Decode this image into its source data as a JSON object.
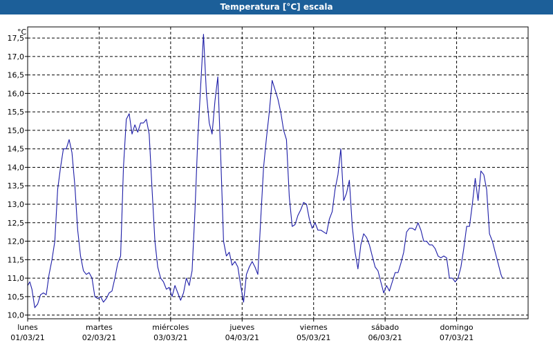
{
  "window": {
    "title": "Temperatura [°C] escala"
  },
  "chart_data": {
    "type": "line",
    "title": "Temperatura [°C] escala",
    "ylabel": "°C",
    "xlabel": "",
    "ylim": [
      9.9,
      17.8
    ],
    "xlim": [
      0,
      7.0
    ],
    "y_ticks": [
      "10,0",
      "10,5",
      "11,0",
      "11,5",
      "12,0",
      "12,5",
      "13,0",
      "13,5",
      "14,0",
      "14,5",
      "15,0",
      "15,5",
      "16,0",
      "16,5",
      "17,0",
      "17,5"
    ],
    "y_tick_values": [
      10.0,
      10.5,
      11.0,
      11.5,
      12.0,
      12.5,
      13.0,
      13.5,
      14.0,
      14.5,
      15.0,
      15.5,
      16.0,
      16.5,
      17.0,
      17.5
    ],
    "x_ticks": [
      {
        "day": "lunes",
        "date": "01/03/21",
        "value": 0
      },
      {
        "day": "martes",
        "date": "02/03/21",
        "value": 1
      },
      {
        "day": "miércoles",
        "date": "03/03/21",
        "value": 2
      },
      {
        "day": "jueves",
        "date": "04/03/21",
        "value": 3
      },
      {
        "day": "viernes",
        "date": "05/03/21",
        "value": 4
      },
      {
        "day": "sábado",
        "date": "06/03/21",
        "value": 5
      },
      {
        "day": "domingo",
        "date": "07/03/21",
        "value": 6
      }
    ],
    "grid": true,
    "colors": {
      "line": "#1a1aa6",
      "titlebar": "#1c5f99",
      "grid": "#000000"
    },
    "series": [
      {
        "values": [
          [
            0.0,
            10.8
          ],
          [
            0.03,
            10.9
          ],
          [
            0.06,
            10.7
          ],
          [
            0.1,
            10.2
          ],
          [
            0.14,
            10.3
          ],
          [
            0.18,
            10.55
          ],
          [
            0.22,
            10.6
          ],
          [
            0.26,
            10.55
          ],
          [
            0.3,
            11.1
          ],
          [
            0.34,
            11.5
          ],
          [
            0.38,
            12.0
          ],
          [
            0.42,
            13.4
          ],
          [
            0.46,
            14.0
          ],
          [
            0.5,
            14.5
          ],
          [
            0.54,
            14.5
          ],
          [
            0.58,
            14.75
          ],
          [
            0.62,
            14.4
          ],
          [
            0.66,
            13.5
          ],
          [
            0.7,
            12.3
          ],
          [
            0.74,
            11.6
          ],
          [
            0.78,
            11.2
          ],
          [
            0.82,
            11.1
          ],
          [
            0.86,
            11.15
          ],
          [
            0.9,
            11.0
          ],
          [
            0.94,
            10.5
          ],
          [
            0.98,
            10.45
          ],
          [
            1.02,
            10.5
          ],
          [
            1.06,
            10.35
          ],
          [
            1.1,
            10.45
          ],
          [
            1.14,
            10.6
          ],
          [
            1.18,
            10.65
          ],
          [
            1.22,
            11.0
          ],
          [
            1.26,
            11.4
          ],
          [
            1.3,
            11.6
          ],
          [
            1.34,
            14.0
          ],
          [
            1.38,
            15.3
          ],
          [
            1.42,
            15.45
          ],
          [
            1.46,
            14.9
          ],
          [
            1.5,
            15.15
          ],
          [
            1.54,
            14.95
          ],
          [
            1.58,
            15.2
          ],
          [
            1.62,
            15.2
          ],
          [
            1.66,
            15.3
          ],
          [
            1.7,
            14.9
          ],
          [
            1.74,
            13.4
          ],
          [
            1.78,
            12.0
          ],
          [
            1.82,
            11.3
          ],
          [
            1.86,
            11.0
          ],
          [
            1.9,
            10.9
          ],
          [
            1.94,
            10.7
          ],
          [
            1.98,
            10.75
          ],
          [
            2.02,
            10.5
          ],
          [
            2.06,
            10.8
          ],
          [
            2.1,
            10.6
          ],
          [
            2.14,
            10.4
          ],
          [
            2.18,
            10.6
          ],
          [
            2.22,
            11.0
          ],
          [
            2.26,
            10.8
          ],
          [
            2.3,
            11.2
          ],
          [
            2.34,
            12.8
          ],
          [
            2.38,
            14.8
          ],
          [
            2.42,
            16.2
          ],
          [
            2.46,
            17.6
          ],
          [
            2.5,
            16.0
          ],
          [
            2.54,
            15.2
          ],
          [
            2.58,
            14.9
          ],
          [
            2.62,
            15.8
          ],
          [
            2.66,
            16.45
          ],
          [
            2.7,
            14.3
          ],
          [
            2.74,
            12.0
          ],
          [
            2.78,
            11.6
          ],
          [
            2.82,
            11.7
          ],
          [
            2.86,
            11.35
          ],
          [
            2.9,
            11.45
          ],
          [
            2.94,
            11.3
          ],
          [
            2.98,
            10.8
          ],
          [
            3.02,
            10.35
          ],
          [
            3.06,
            11.1
          ],
          [
            3.1,
            11.3
          ],
          [
            3.14,
            11.45
          ],
          [
            3.18,
            11.3
          ],
          [
            3.22,
            11.1
          ],
          [
            3.26,
            12.6
          ],
          [
            3.3,
            14.0
          ],
          [
            3.34,
            14.8
          ],
          [
            3.38,
            15.5
          ],
          [
            3.42,
            16.35
          ],
          [
            3.46,
            16.1
          ],
          [
            3.5,
            15.85
          ],
          [
            3.54,
            15.5
          ],
          [
            3.58,
            15.0
          ],
          [
            3.62,
            14.75
          ],
          [
            3.66,
            13.2
          ],
          [
            3.7,
            12.4
          ],
          [
            3.74,
            12.45
          ],
          [
            3.78,
            12.7
          ],
          [
            3.82,
            12.85
          ],
          [
            3.86,
            13.05
          ],
          [
            3.9,
            13.0
          ],
          [
            3.94,
            12.6
          ],
          [
            3.98,
            12.35
          ],
          [
            4.02,
            12.5
          ],
          [
            4.06,
            12.3
          ],
          [
            4.1,
            12.3
          ],
          [
            4.14,
            12.25
          ],
          [
            4.18,
            12.2
          ],
          [
            4.22,
            12.6
          ],
          [
            4.26,
            12.8
          ],
          [
            4.3,
            13.4
          ],
          [
            4.34,
            13.8
          ],
          [
            4.38,
            14.5
          ],
          [
            4.42,
            13.1
          ],
          [
            4.46,
            13.3
          ],
          [
            4.5,
            13.65
          ],
          [
            4.54,
            12.4
          ],
          [
            4.58,
            11.7
          ],
          [
            4.62,
            11.25
          ],
          [
            4.66,
            11.9
          ],
          [
            4.7,
            12.2
          ],
          [
            4.74,
            12.1
          ],
          [
            4.78,
            11.9
          ],
          [
            4.82,
            11.6
          ],
          [
            4.86,
            11.3
          ],
          [
            4.9,
            11.2
          ],
          [
            4.94,
            10.9
          ],
          [
            4.98,
            10.6
          ],
          [
            5.02,
            10.8
          ],
          [
            5.06,
            10.65
          ],
          [
            5.1,
            10.9
          ],
          [
            5.14,
            11.15
          ],
          [
            5.18,
            11.15
          ],
          [
            5.22,
            11.4
          ],
          [
            5.26,
            11.7
          ],
          [
            5.3,
            12.25
          ],
          [
            5.34,
            12.35
          ],
          [
            5.38,
            12.35
          ],
          [
            5.42,
            12.3
          ],
          [
            5.46,
            12.5
          ],
          [
            5.5,
            12.3
          ],
          [
            5.54,
            12.0
          ],
          [
            5.58,
            12.0
          ],
          [
            5.62,
            11.9
          ],
          [
            5.66,
            11.9
          ],
          [
            5.7,
            11.8
          ],
          [
            5.74,
            11.6
          ],
          [
            5.78,
            11.55
          ],
          [
            5.82,
            11.6
          ],
          [
            5.86,
            11.55
          ],
          [
            5.9,
            11.0
          ],
          [
            5.94,
            11.0
          ],
          [
            5.98,
            10.9
          ],
          [
            6.02,
            11.0
          ],
          [
            6.06,
            11.3
          ],
          [
            6.1,
            11.8
          ],
          [
            6.14,
            12.4
          ],
          [
            6.18,
            12.4
          ],
          [
            6.22,
            13.0
          ],
          [
            6.26,
            13.7
          ],
          [
            6.3,
            13.1
          ],
          [
            6.34,
            13.9
          ],
          [
            6.38,
            13.8
          ],
          [
            6.42,
            13.4
          ],
          [
            6.46,
            12.2
          ],
          [
            6.5,
            12.0
          ],
          [
            6.54,
            11.7
          ],
          [
            6.58,
            11.4
          ],
          [
            6.62,
            11.1
          ],
          [
            6.64,
            11.0
          ]
        ]
      }
    ]
  }
}
